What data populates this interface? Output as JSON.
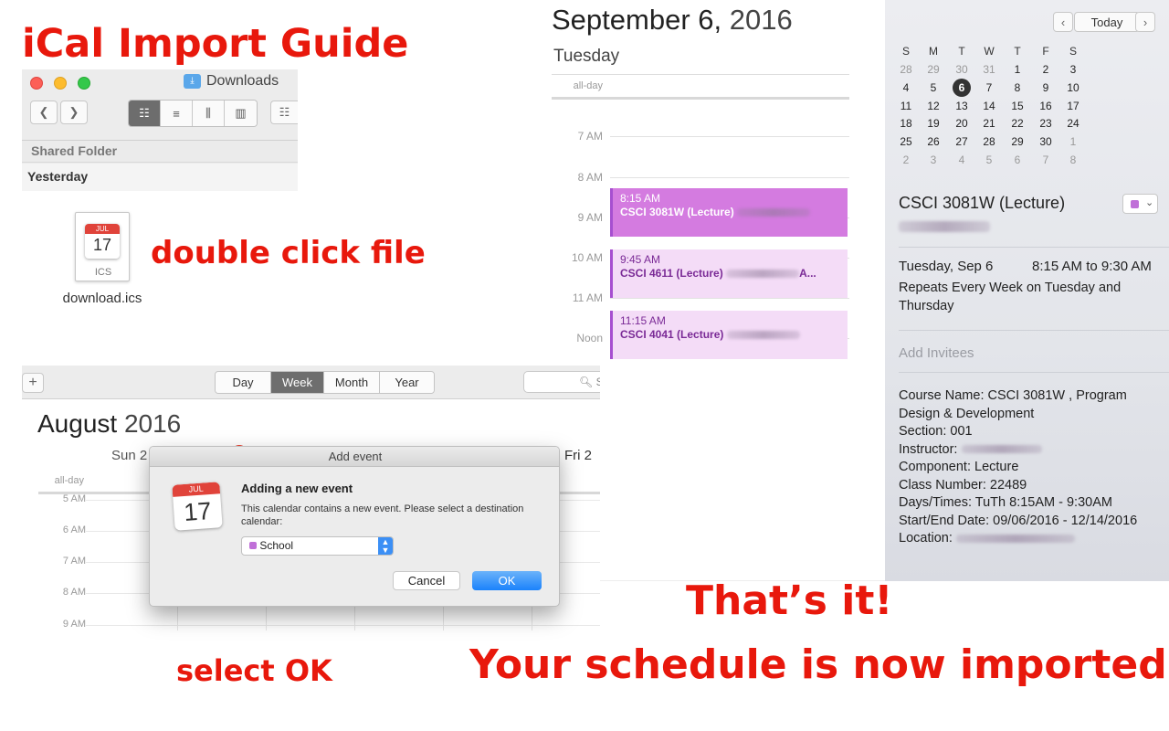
{
  "headings": {
    "title": "iCal Import Guide",
    "step1": "double click file",
    "step2": "select OK",
    "done1": "That’s it!",
    "done2": "Your schedule is now imported!"
  },
  "finder": {
    "window_title": "Downloads",
    "sidebar_section": "Shared Folder",
    "group_label": "Yesterday",
    "file_name": "download.ics",
    "file_icon_month": "JUL",
    "file_icon_day": "17",
    "file_type": "ICS"
  },
  "calendar_window": {
    "views": [
      "Day",
      "Week",
      "Month",
      "Year"
    ],
    "active_view": "Week",
    "month": "August",
    "year": "2016",
    "search_placeholder": "S",
    "col_day_left": "Sun 2",
    "col_day_right": "Fri 2",
    "allday_label": "all-day",
    "hours": [
      "5 AM",
      "6 AM",
      "7 AM",
      "8 AM",
      "9 AM"
    ]
  },
  "dialog": {
    "title": "Add event",
    "heading": "Adding a new event",
    "message": "This calendar contains a new event. Please select a destination calendar:",
    "calendar_choice": "School",
    "cancel": "Cancel",
    "ok": "OK",
    "icon_month": "JUL",
    "icon_day": "17"
  },
  "day_view": {
    "date_bold": "September 6,",
    "year": "2016",
    "weekday": "Tuesday",
    "allday_label": "all-day",
    "hours": [
      "7 AM",
      "8 AM",
      "9 AM",
      "10 AM",
      "11 AM",
      "Noon"
    ],
    "events": [
      {
        "time": "8:15 AM",
        "name": "CSCI 3081W (Lecture)",
        "suffix": "",
        "style": "selected"
      },
      {
        "time": "9:45 AM",
        "name": "CSCI 4611 (Lecture)",
        "suffix": "A...",
        "style": "normal"
      },
      {
        "time": "11:15 AM",
        "name": "CSCI 4041 (Lecture)",
        "suffix": "",
        "style": "normal"
      }
    ],
    "colors": {
      "selected": "#d47be0",
      "normal": "#f4dcf7",
      "accent": "#a64fd0"
    }
  },
  "mini_calendar": {
    "today_button": "Today",
    "weekdays": [
      "S",
      "M",
      "T",
      "W",
      "T",
      "F",
      "S"
    ],
    "weeks": [
      [
        "28",
        "29",
        "30",
        "31",
        "1",
        "2",
        "3"
      ],
      [
        "4",
        "5",
        "6",
        "7",
        "8",
        "9",
        "10"
      ],
      [
        "11",
        "12",
        "13",
        "14",
        "15",
        "16",
        "17"
      ],
      [
        "18",
        "19",
        "20",
        "21",
        "22",
        "23",
        "24"
      ],
      [
        "25",
        "26",
        "27",
        "28",
        "29",
        "30",
        "1"
      ],
      [
        "2",
        "3",
        "4",
        "5",
        "6",
        "7",
        "8"
      ]
    ],
    "selected_day": "6"
  },
  "event_detail": {
    "title": "CSCI 3081W (Lecture)",
    "date": "Tuesday, Sep 6",
    "time_range": "8:15 AM to 9:30 AM",
    "repeat": "Repeats Every Week on Tuesday and Thursday",
    "invitees_placeholder": "Add Invitees",
    "notes": {
      "course_name": "Course Name: CSCI 3081W , Program Design & Development",
      "section": "Section: 001",
      "instructor": "Instructor:",
      "component": "Component: Lecture",
      "class_number": "Class Number: 22489",
      "days_times": "Days/Times: TuTh 8:15AM - 9:30AM",
      "start_end": "Start/End Date: 09/06/2016 - 12/14/2016",
      "location": "Location:"
    },
    "calendar_color": "#c070d8"
  }
}
